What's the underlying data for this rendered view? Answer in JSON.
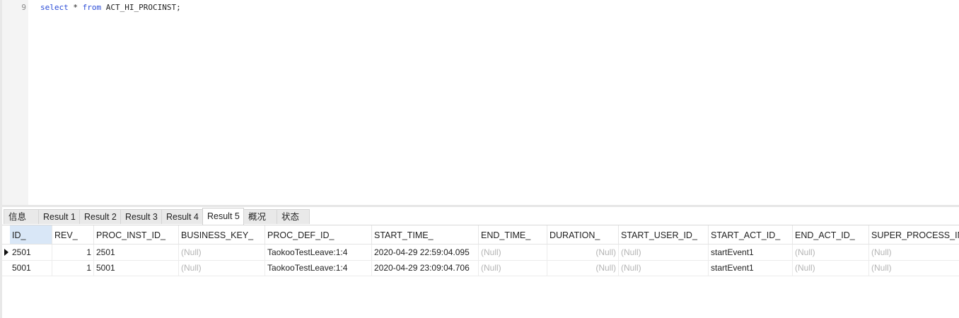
{
  "editor": {
    "line_number": "9",
    "tokens": {
      "kw1": "select",
      "star": " * ",
      "kw2": "from",
      "rest": " ACT_HI_PROCINST;"
    }
  },
  "tabs": [
    {
      "label": "信息"
    },
    {
      "label": "Result 1"
    },
    {
      "label": "Result 2"
    },
    {
      "label": "Result 3"
    },
    {
      "label": "Result 4"
    },
    {
      "label": "Result 5"
    },
    {
      "label": "概况"
    },
    {
      "label": "状态"
    }
  ],
  "active_tab_index": 5,
  "table": {
    "columns": [
      "ID_",
      "REV_",
      "PROC_INST_ID_",
      "BUSINESS_KEY_",
      "PROC_DEF_ID_",
      "START_TIME_",
      "END_TIME_",
      "DURATION_",
      "START_USER_ID_",
      "START_ACT_ID_",
      "END_ACT_ID_",
      "SUPER_PROCESS_INS"
    ],
    "rows": [
      [
        "2501",
        "1",
        "2501",
        "(Null)",
        "TaokooTestLeave:1:4",
        "2020-04-29 22:59:04.095",
        "(Null)",
        "(Null)",
        "(Null)",
        "startEvent1",
        "(Null)",
        "(Null)"
      ],
      [
        "5001",
        "1",
        "5001",
        "(Null)",
        "TaokooTestLeave:1:4",
        "2020-04-29 23:09:04.706",
        "(Null)",
        "(Null)",
        "(Null)",
        "startEvent1",
        "(Null)",
        "(Null)"
      ]
    ],
    "selected_row_index": 0
  },
  "colors": {
    "keyword": "#2a4bd7",
    "null_text": "#b4b4b4",
    "header_selected": "#d9e7f7"
  }
}
